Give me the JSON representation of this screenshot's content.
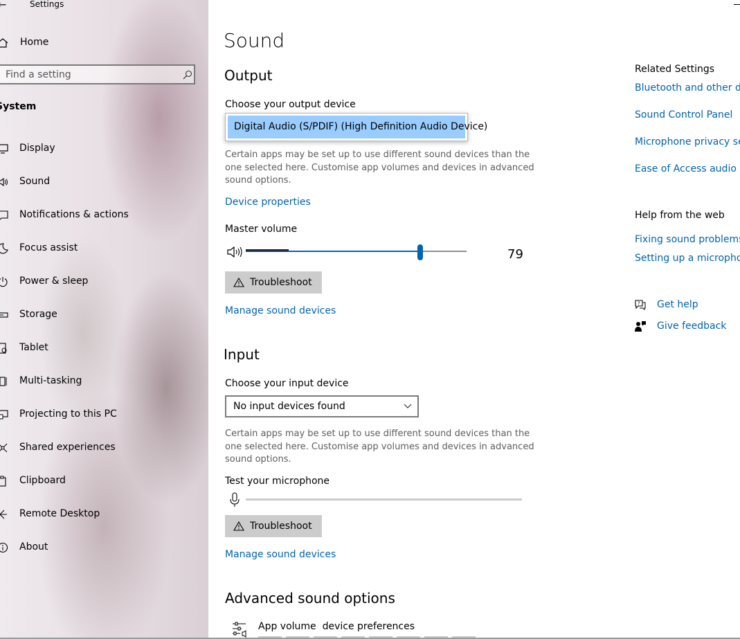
{
  "window": {
    "title": "Settings"
  },
  "sidebar": {
    "home_label": "Home",
    "search_placeholder": "Find a setting",
    "section_title": "System",
    "items": [
      {
        "label": "Display",
        "icon": "display-icon"
      },
      {
        "label": "Sound",
        "icon": "speaker-icon"
      },
      {
        "label": "Notifications & actions",
        "icon": "notifications-icon"
      },
      {
        "label": "Focus assist",
        "icon": "moon-icon"
      },
      {
        "label": "Power & sleep",
        "icon": "power-icon"
      },
      {
        "label": "Storage",
        "icon": "storage-icon"
      },
      {
        "label": "Tablet",
        "icon": "tablet-icon"
      },
      {
        "label": "Multi-tasking",
        "icon": "multitasking-icon"
      },
      {
        "label": "Projecting to this PC",
        "icon": "projecting-icon"
      },
      {
        "label": "Shared experiences",
        "icon": "shared-icon"
      },
      {
        "label": "Clipboard",
        "icon": "clipboard-icon"
      },
      {
        "label": "Remote Desktop",
        "icon": "remote-desktop-icon"
      },
      {
        "label": "About",
        "icon": "info-icon"
      }
    ]
  },
  "main": {
    "title": "Sound",
    "output": {
      "heading": "Output",
      "choose_label": "Choose your output device",
      "selected_device": "Digital Audio (S/PDIF) (High Definition Audio Device)",
      "note": "Certain apps may be set up to use different sound devices than the one selected here. Customise app volumes and devices in advanced sound options.",
      "device_properties_link": "Device properties",
      "master_volume_label": "Master volume",
      "volume_value": "79",
      "volume_level": 0.79,
      "troubleshoot_label": "Troubleshoot",
      "manage_link": "Manage sound devices"
    },
    "input": {
      "heading": "Input",
      "choose_label": "Choose your input device",
      "selected_device": "No input devices found",
      "note": "Certain apps may be set up to use different sound devices than the one selected here. Customise app volumes and devices in advanced sound options.",
      "test_label": "Test your microphone",
      "troubleshoot_label": "Troubleshoot",
      "manage_link": "Manage sound devices"
    },
    "advanced": {
      "heading": "Advanced sound options",
      "app_volume_title": "App volume  device preferences"
    }
  },
  "right": {
    "related_heading": "Related Settings",
    "related_links": [
      "Bluetooth and other devi",
      "Sound Control Panel",
      "Microphone privacy setti",
      "Ease of Access audio sett"
    ],
    "help_heading": "Help from the web",
    "help_links": [
      "Fixing sound problems",
      "Setting up a microphone"
    ],
    "get_help": "Get help",
    "give_feedback": "Give feedback"
  },
  "colors": {
    "accent": "#0063b1",
    "selection": "#99ccff",
    "button": "#cccccc"
  }
}
